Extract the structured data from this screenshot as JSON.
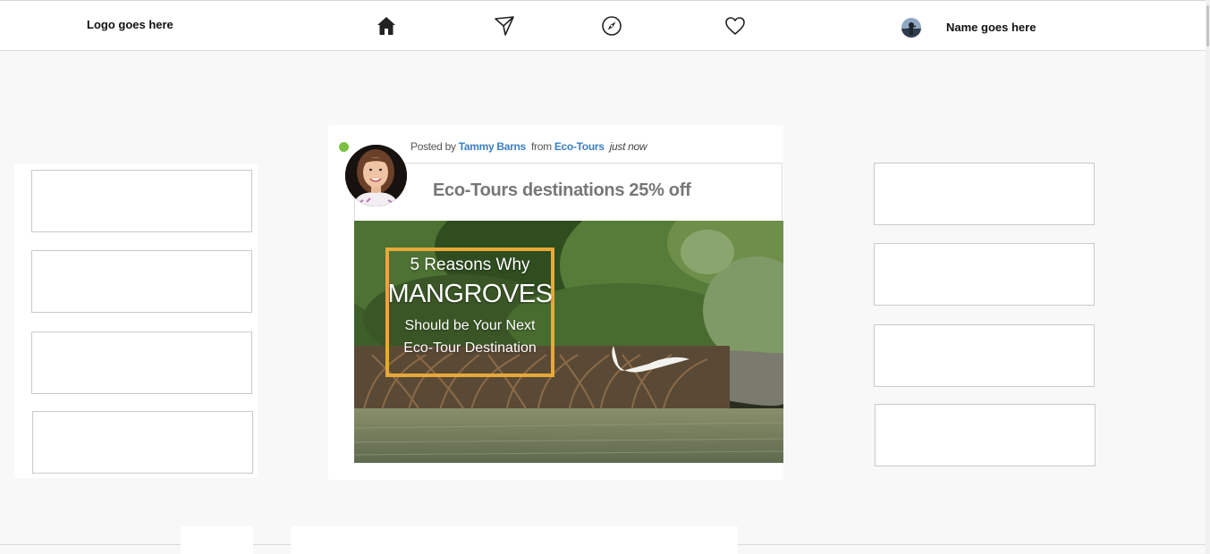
{
  "header": {
    "logo_text": "Logo goes here",
    "profile_name": "Name goes here",
    "nav_icons": [
      "home-icon",
      "send-icon",
      "compass-icon",
      "heart-icon"
    ]
  },
  "post": {
    "posted_by_prefix": "Posted by",
    "author": "Tammy Barns",
    "from_prefix": "from",
    "group": "Eco-Tours",
    "time": "just now",
    "title": "Eco-Tours destinations 25% off",
    "image": {
      "line1": "5 Reasons Why",
      "line2": "MANGROVES",
      "line3": "Should be Your Next",
      "line4": "Eco-Tour Destination"
    }
  },
  "colors": {
    "online_dot": "#7ac143",
    "link": "#3a7fc4",
    "frame": "#e7a93a"
  }
}
